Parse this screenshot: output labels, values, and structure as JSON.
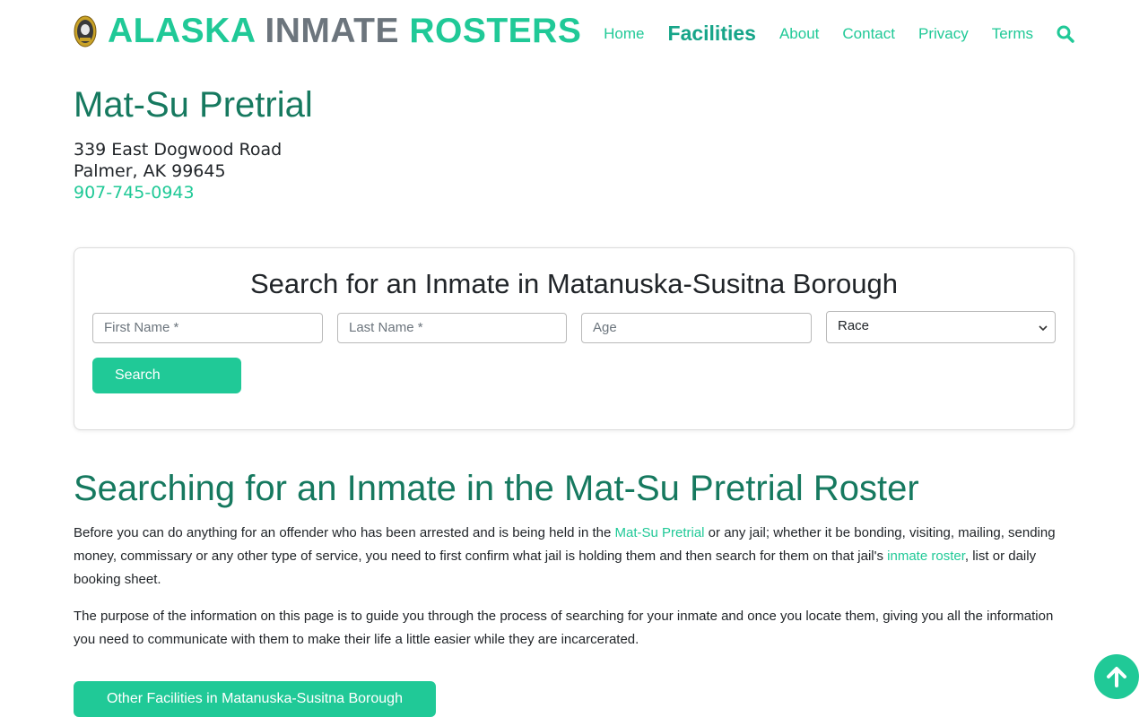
{
  "header": {
    "brand_part1": "ALASKA",
    "brand_part2": "INMATE",
    "brand_part3": "ROSTERS",
    "nav": [
      "Home",
      "Facilities",
      "About",
      "Contact",
      "Privacy",
      "Terms"
    ],
    "active_nav": "Facilities",
    "search_icon": "search-icon"
  },
  "facility": {
    "title": "Mat-Su Pretrial",
    "address_line1": "339 East Dogwood Road",
    "address_line2": "Palmer, AK 99645",
    "phone": "907-745-0943"
  },
  "search_card": {
    "title": "Search for an Inmate in Matanuska-Susitna Borough",
    "first_name_placeholder": "First Name *",
    "last_name_placeholder": "Last Name *",
    "age_placeholder": "Age",
    "race_selected": "Race",
    "search_button": "Search"
  },
  "article": {
    "title": "Searching for an Inmate in the Mat-Su Pretrial Roster",
    "p1_a": "Before you can do anything for an offender who has been arrested and is being held in the ",
    "p1_link1": "Mat-Su Pretrial",
    "p1_b": " or any jail; whether it be bonding, visiting, mailing, sending money, commissary or any other type of service, you need to first confirm what jail is holding them and then search for them on that jail's ",
    "p1_link2": "inmate roster",
    "p1_c": ", list or daily booking sheet.",
    "p2": "The purpose of the information on this page is to guide you through the process of searching for your inmate and once you locate them, giving you all the information you need to communicate with them to make their life a little easier while they are incarcerated."
  },
  "other_facilities_button": "Other Facilities in Matanuska-Susitna Borough",
  "colors": {
    "accent": "#20c997",
    "heading": "#16795f",
    "muted": "#6c757d"
  }
}
